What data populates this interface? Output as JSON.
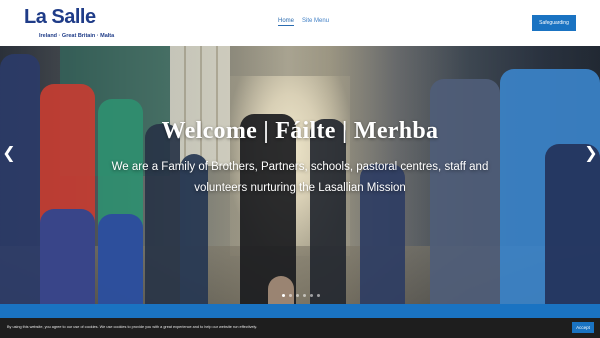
{
  "brand": {
    "logo_text": "La Salle",
    "logo_subtitle": "Ireland · Great Britain · Malta"
  },
  "nav": {
    "items": [
      {
        "label": "Home",
        "active": true
      },
      {
        "label": "Site Menu",
        "active": false
      }
    ]
  },
  "header": {
    "cta_label": "Safeguarding"
  },
  "hero": {
    "title": "Welcome | Fáilte | Merhba",
    "subtitle": "We are a Family of Brothers, Partners, schools, pastoral centres, staff and volunteers nurturing the Lasallian Mission",
    "prev_icon": "chevron-left-icon",
    "next_icon": "chevron-right-icon",
    "slide_count": 6,
    "active_slide": 1
  },
  "cookie": {
    "text": "By using this website, you agree to our use of cookies. We use cookies to provide you with a great experience and to help our website run effectively.",
    "accept_label": "Accept"
  },
  "colors": {
    "brand_blue": "#1f3c88",
    "accent_blue": "#1a73c2",
    "cookie_bg": "#1e1e1e"
  }
}
